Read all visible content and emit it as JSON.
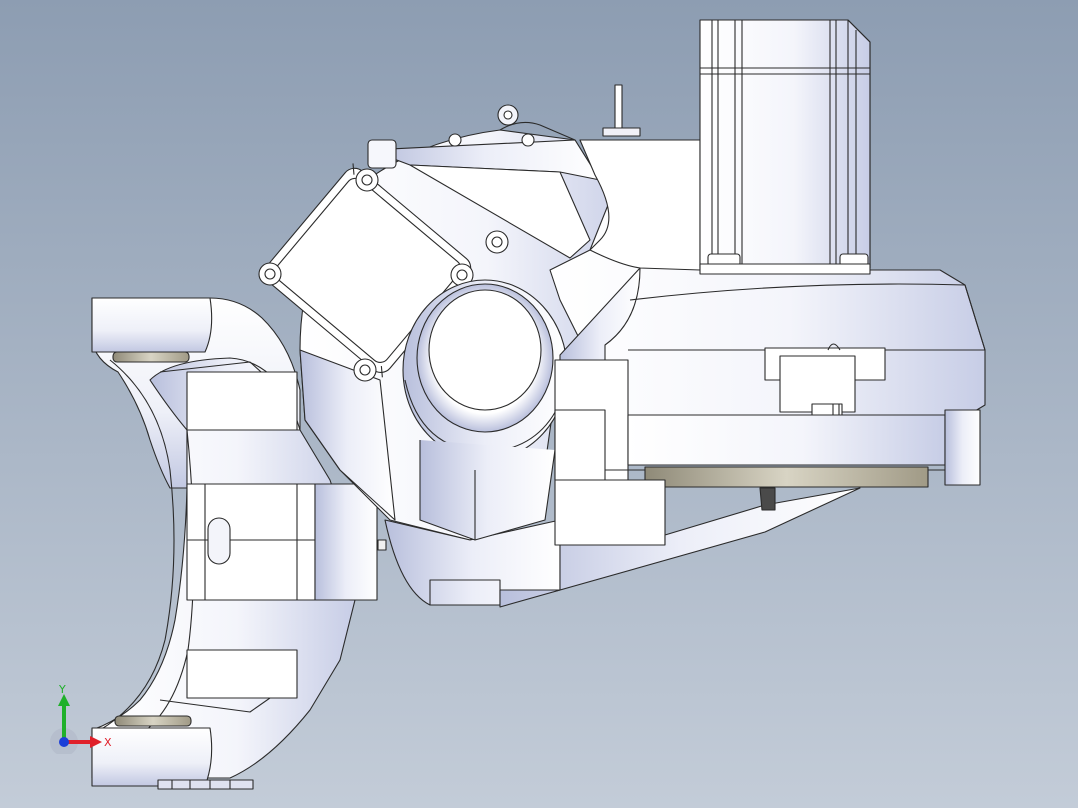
{
  "viewport": {
    "background_top": "#8d9db2",
    "background_bottom": "#c3ccd8"
  },
  "model": {
    "fill": "#ffffff",
    "shade": "#c9cfe8",
    "edge": "#2b2b2b"
  },
  "triad": {
    "x_label": "X",
    "y_label": "Y",
    "x_color": "#e0202a",
    "y_color": "#1fb02a",
    "z_color": "#1c3fd8"
  }
}
